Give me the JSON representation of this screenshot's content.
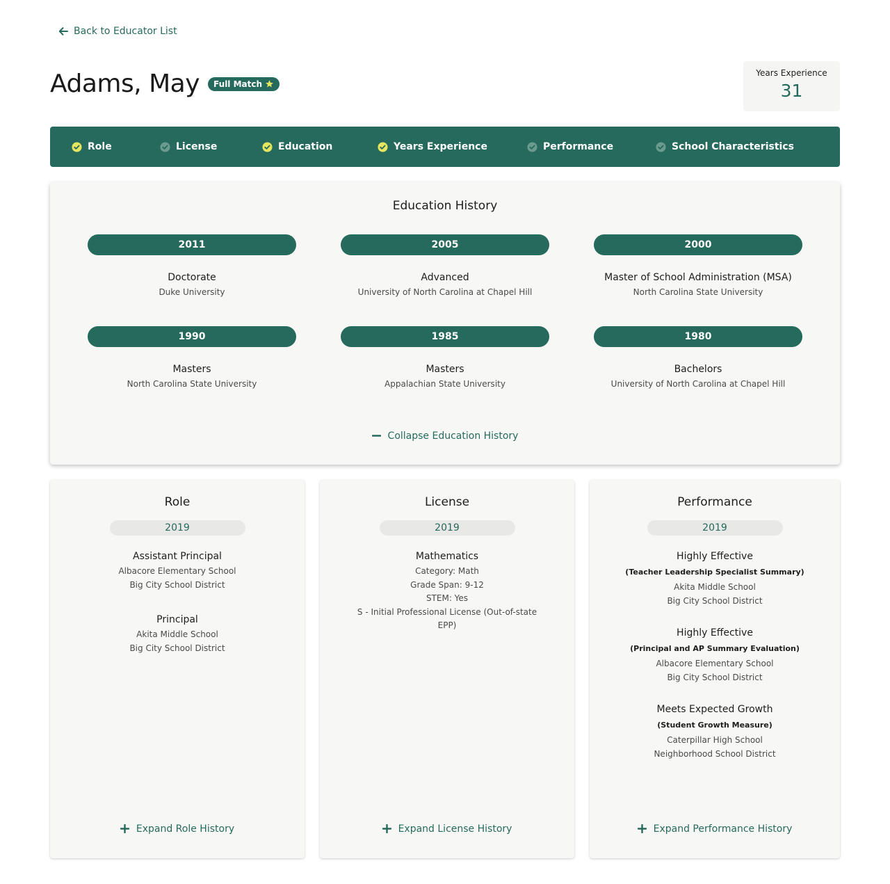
{
  "nav": {
    "back_label": "Back to Educator List"
  },
  "educator": {
    "name": "Adams, May",
    "match_badge": "Full Match"
  },
  "years_experience": {
    "label": "Years Experience",
    "value": "31"
  },
  "criteria": [
    {
      "label": "Role",
      "matched": true
    },
    {
      "label": "License",
      "matched": false
    },
    {
      "label": "Education",
      "matched": true
    },
    {
      "label": "Years Experience",
      "matched": true
    },
    {
      "label": "Performance",
      "matched": false
    },
    {
      "label": "School Characteristics",
      "matched": false
    }
  ],
  "colors": {
    "primary": "#256a5c",
    "match_check": "#e5e55f",
    "star": "#e5e55f"
  },
  "education": {
    "title": "Education History",
    "entries": [
      {
        "year": "2011",
        "degree": "Doctorate",
        "school": "Duke University"
      },
      {
        "year": "2005",
        "degree": "Advanced",
        "school": "University of North Carolina at Chapel Hill"
      },
      {
        "year": "2000",
        "degree": "Master of School Administration (MSA)",
        "school": "North Carolina State University"
      },
      {
        "year": "1990",
        "degree": "Masters",
        "school": "North Carolina State University"
      },
      {
        "year": "1985",
        "degree": "Masters",
        "school": "Appalachian State University"
      },
      {
        "year": "1980",
        "degree": "Bachelors",
        "school": "University of North Carolina at Chapel Hill"
      }
    ],
    "collapse_label": "Collapse Education History"
  },
  "role": {
    "title": "Role",
    "year": "2019",
    "records": [
      {
        "title": "Assistant Principal",
        "school": "Albacore Elementary School",
        "district": "Big City School District"
      },
      {
        "title": "Principal",
        "school": "Akita Middle School",
        "district": "Big City School District"
      }
    ],
    "expand_label": "Expand Role History"
  },
  "license": {
    "title": "License",
    "year": "2019",
    "record": {
      "title": "Mathematics",
      "category": "Category: Math",
      "grade_span": "Grade Span: 9-12",
      "stem": "STEM: Yes",
      "type_line1": "S - Initial Professional License (Out-of-state",
      "type_line2": "EPP)"
    },
    "expand_label": "Expand License History"
  },
  "performance": {
    "title": "Performance",
    "year": "2019",
    "records": [
      {
        "rating": "Highly Effective",
        "evaluation": "(Teacher Leadership Specialist Summary)",
        "school": "Akita Middle School",
        "district": "Big City School District"
      },
      {
        "rating": "Highly Effective",
        "evaluation": "(Principal and AP Summary Evaluation)",
        "school": "Albacore Elementary School",
        "district": "Big City School District"
      },
      {
        "rating": "Meets Expected Growth",
        "evaluation": "(Student Growth Measure)",
        "school": "Caterpillar High School",
        "district": "Neighborhood School District"
      }
    ],
    "expand_label": "Expand Performance History"
  }
}
